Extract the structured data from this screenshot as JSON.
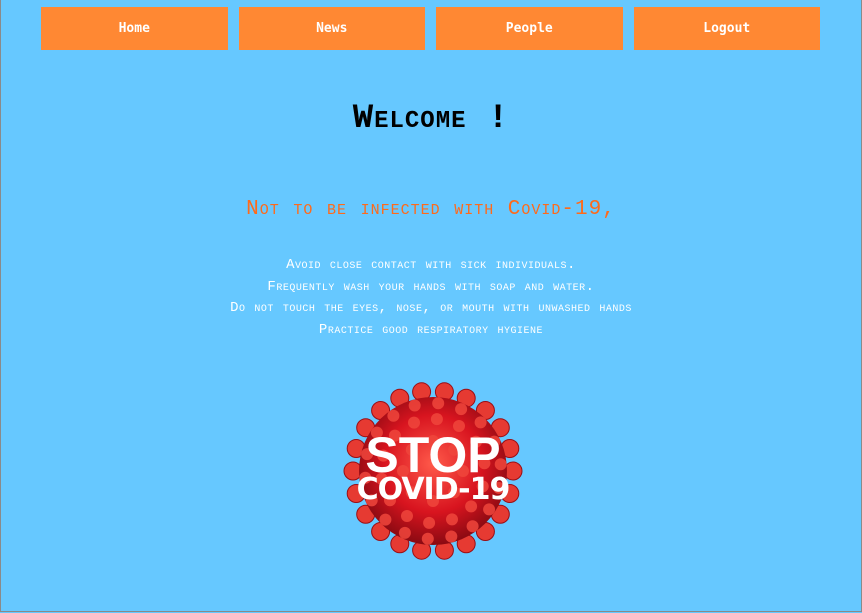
{
  "nav": {
    "items": [
      {
        "label": "Home"
      },
      {
        "label": "News"
      },
      {
        "label": "People"
      },
      {
        "label": "Logout"
      }
    ]
  },
  "main": {
    "title": "Welcome !",
    "subtitle": "Not to be infected with Covid-19,",
    "tips": [
      "Avoid close contact with sick individuals.",
      "Frequently wash your hands with soap and water.",
      "Do not touch the eyes, nose, or mouth with unwashed hands",
      "Practice good respiratory hygiene"
    ],
    "image": {
      "line1": "STOP",
      "line2": "COVID-19",
      "icon": "virus-image"
    }
  },
  "colors": {
    "background": "#66c8ff",
    "nav_button": "#ff8833",
    "subtitle": "#ff6a1a",
    "virus": "#e0202a"
  }
}
